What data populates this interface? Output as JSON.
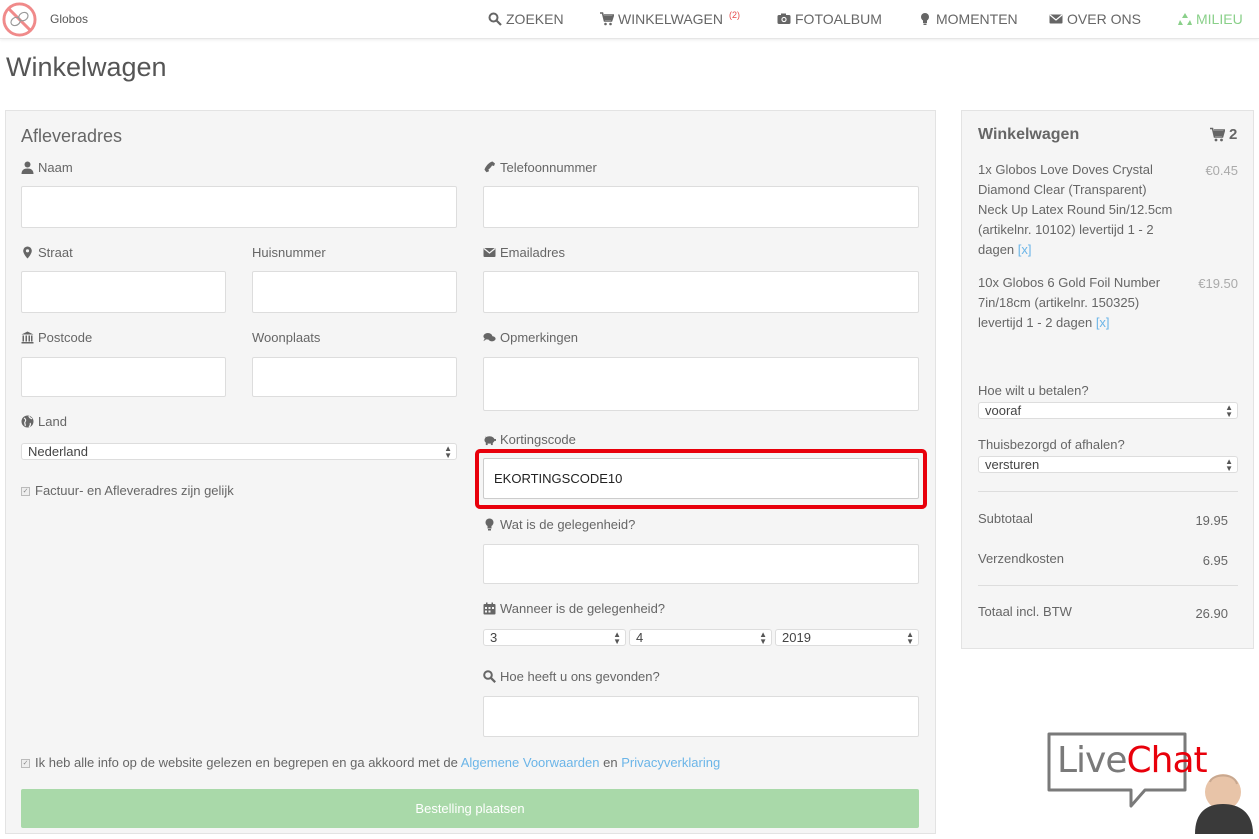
{
  "nav": {
    "brand": "Globos",
    "items": [
      {
        "label": "ZOEKEN",
        "icon": "search-icon"
      },
      {
        "label": "WINKELWAGEN",
        "badge": "(2)",
        "icon": "cart-icon"
      },
      {
        "label": "FOTOALBUM",
        "icon": "camera-icon"
      },
      {
        "label": "MOMENTEN",
        "icon": "lightbulb-icon"
      },
      {
        "label": "OVER ONS",
        "icon": "envelope-icon"
      },
      {
        "label": "MILIEU",
        "icon": "recycle-icon"
      }
    ]
  },
  "page_title": "Winkelwagen",
  "form": {
    "section_title": "Afleveradres",
    "naam_label": "Naam",
    "straat_label": "Straat",
    "huisnummer_label": "Huisnummer",
    "postcode_label": "Postcode",
    "woonplaats_label": "Woonplaats",
    "land_label": "Land",
    "land_value": "Nederland",
    "same_address_label": "Factuur- en Afleveradres zijn gelijk",
    "telefoon_label": "Telefoonnummer",
    "email_label": "Emailadres",
    "opmerkingen_label": "Opmerkingen",
    "korting_label": "Kortingscode",
    "korting_value": "EKORTINGSCODE10",
    "gelegenheid_label": "Wat is de gelegenheid?",
    "wanneer_label": "Wanneer is de gelegenheid?",
    "date_day": "3",
    "date_month": "4",
    "date_year": "2019",
    "gevonden_label": "Hoe heeft u ons gevonden?",
    "terms_text": "Ik heb alle info op de website gelezen en begrepen en ga akkoord met de",
    "terms_link1": "Algemene Voorwaarden",
    "terms_and": "en",
    "terms_link2": "Privacyverklaring",
    "order_button": "Bestelling plaatsen"
  },
  "cart": {
    "title": "Winkelwagen",
    "count": "2",
    "items": [
      {
        "text": "1x Globos Love Doves Crystal Diamond Clear (Transparent) Neck Up Latex Round 5in/12.5cm (artikelnr. 10102) levertijd 1 - 2 dagen",
        "remove": "[x]",
        "price": "€0.45"
      },
      {
        "text": "10x Globos 6 Gold Foil Number 7in/18cm (artikelnr. 150325) levertijd 1 - 2 dagen",
        "remove": "[x]",
        "price": "€19.50"
      }
    ],
    "pay_label": "Hoe wilt u betalen?",
    "pay_value": "vooraf",
    "delivery_label": "Thuisbezorgd of afhalen?",
    "delivery_value": "versturen",
    "subtotal_label": "Subtotaal",
    "subtotal_value": "19.95",
    "shipping_label": "Verzendkosten",
    "shipping_value": "6.95",
    "total_label": "Totaal incl. BTW",
    "total_value": "26.90"
  },
  "livechat": {
    "label": "LiveChat"
  },
  "colors": {
    "accent_green": "#a9d9a9",
    "link_blue": "#6bb5e8",
    "highlight_red": "#e8000b",
    "badge_red": "#e64c4c"
  }
}
